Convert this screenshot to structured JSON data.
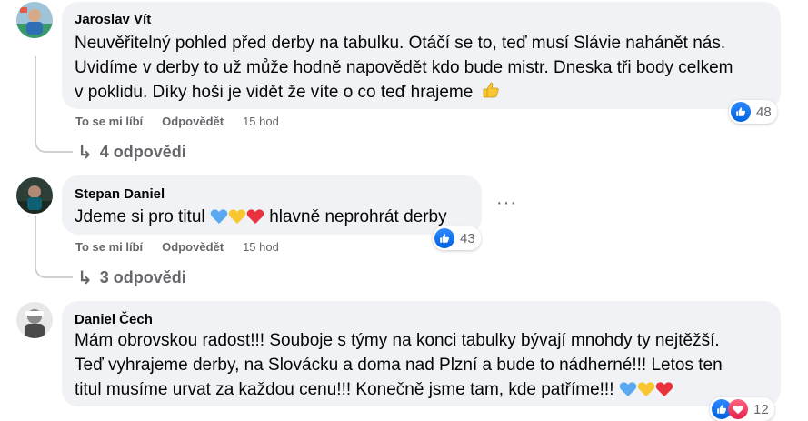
{
  "comments": [
    {
      "author": "Jaroslav Vít",
      "lines": [
        "Neuvěřitelný pohled před derby na tabulku. Otáčí se to, teď musí Slávie nahánět nás.",
        "Uvidíme v derby to už může hodně napovědět kdo bude mistr. Dneska tři body celkem",
        "v poklidu. Díky hoši je vidět že víte o co teď hrajeme"
      ],
      "emoji_end": "👍",
      "like_label": "To se mi líbí",
      "reply_label": "Odpovědět",
      "time": "15 hod",
      "reaction_count": "48",
      "replies_label": "4 odpovědi"
    },
    {
      "author": "Stepan Daniel",
      "text_after": "hlavně neprohrát derby",
      "text_before": "Jdeme si pro titul",
      "hearts": [
        "blue",
        "yellow",
        "red"
      ],
      "like_label": "To se mi líbí",
      "reply_label": "Odpovědět",
      "time": "15 hod",
      "reaction_count": "43",
      "replies_label": "3 odpovědi",
      "more_label": "···"
    },
    {
      "author": "Daniel Čech",
      "lines": [
        "Mám obrovskou radost!!! Souboje s týmy na konci tabulky bývají mnohdy ty nejtěžší.",
        "Teď vyhrajeme derby, na Slovácku a doma nad Plzní a bude to nádherné!!! Letos ten",
        "titul musíme urvat za každou cenu!!! Konečně jsme tam, kde patříme!!!"
      ],
      "hearts": [
        "blue",
        "yellow",
        "red"
      ],
      "reaction_count": "12"
    }
  ],
  "colors": {
    "heart_blue": "#5aa9f0",
    "heart_yellow": "#f7c630",
    "heart_red": "#e8333f",
    "like_blue": "#1877f2",
    "bubble": "#f0f2f5",
    "secondary_text": "#65676b"
  },
  "icons": [
    "like-icon",
    "love-icon",
    "reply-arrow-icon",
    "more-dots-icon",
    "thumbs-up-emoji"
  ]
}
